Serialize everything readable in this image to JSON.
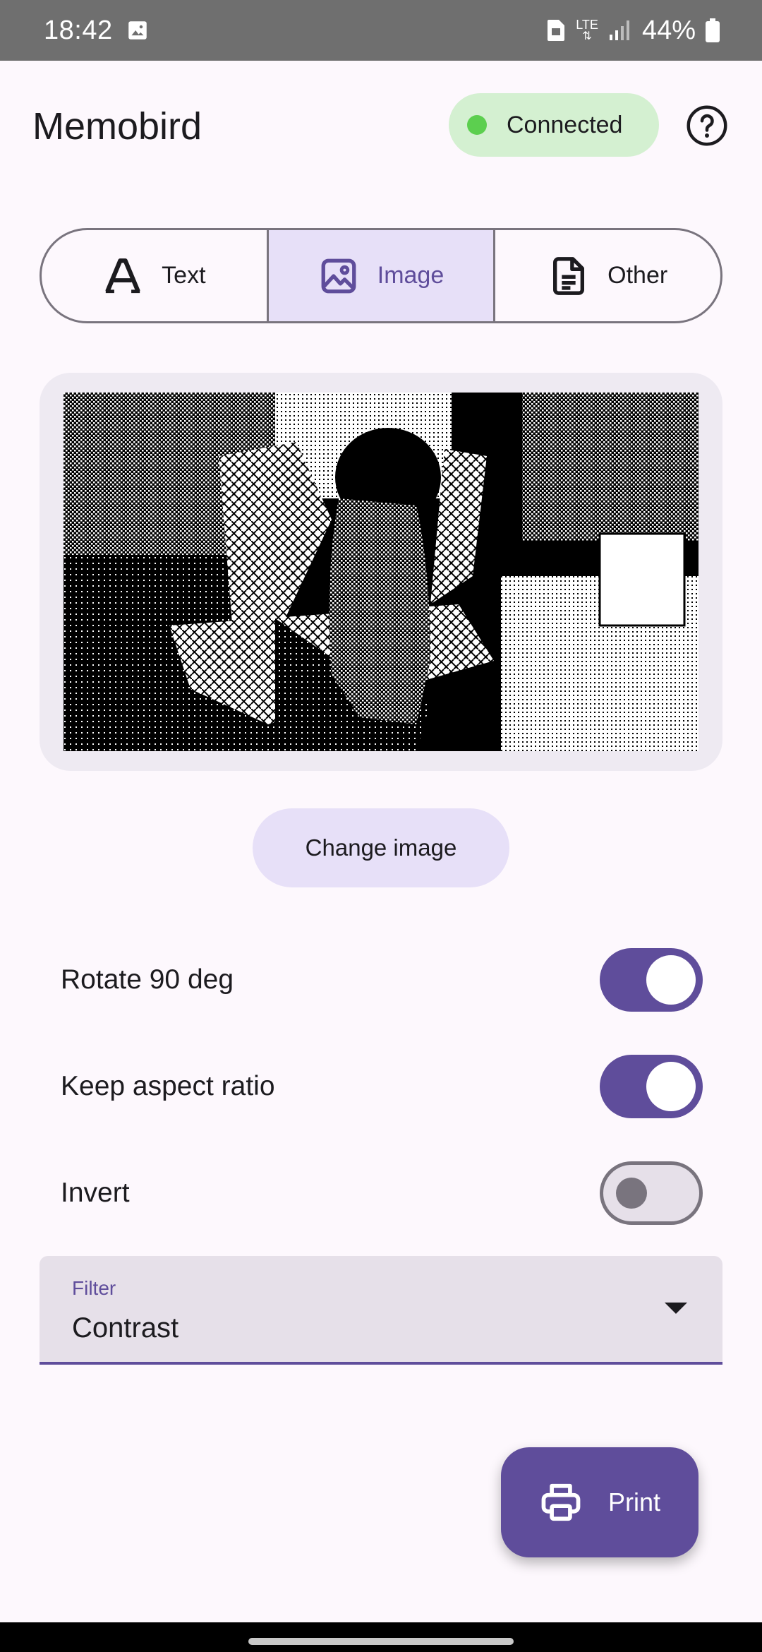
{
  "status_bar": {
    "time": "18:42",
    "network": "LTE",
    "battery": "44%"
  },
  "header": {
    "title": "Memobird",
    "connection_status": "Connected",
    "status_color": "#5ccf4f"
  },
  "mode_tabs": [
    {
      "label": "Text",
      "icon": "text-format-icon",
      "selected": false
    },
    {
      "label": "Image",
      "icon": "image-icon",
      "selected": true
    },
    {
      "label": "Other",
      "icon": "document-icon",
      "selected": false
    }
  ],
  "preview": {
    "description_icon": "dithered-photo"
  },
  "change_image_label": "Change image",
  "options": [
    {
      "label": "Rotate 90 deg",
      "on": true
    },
    {
      "label": "Keep aspect ratio",
      "on": true
    },
    {
      "label": "Invert",
      "on": false
    }
  ],
  "filter": {
    "label": "Filter",
    "value": "Contrast"
  },
  "print_button": {
    "label": "Print",
    "icon": "printer-icon"
  },
  "colors": {
    "accent": "#5f4d9b",
    "selected_tab_bg": "#e7e0f8",
    "chip_bg": "#d4f0d1"
  }
}
